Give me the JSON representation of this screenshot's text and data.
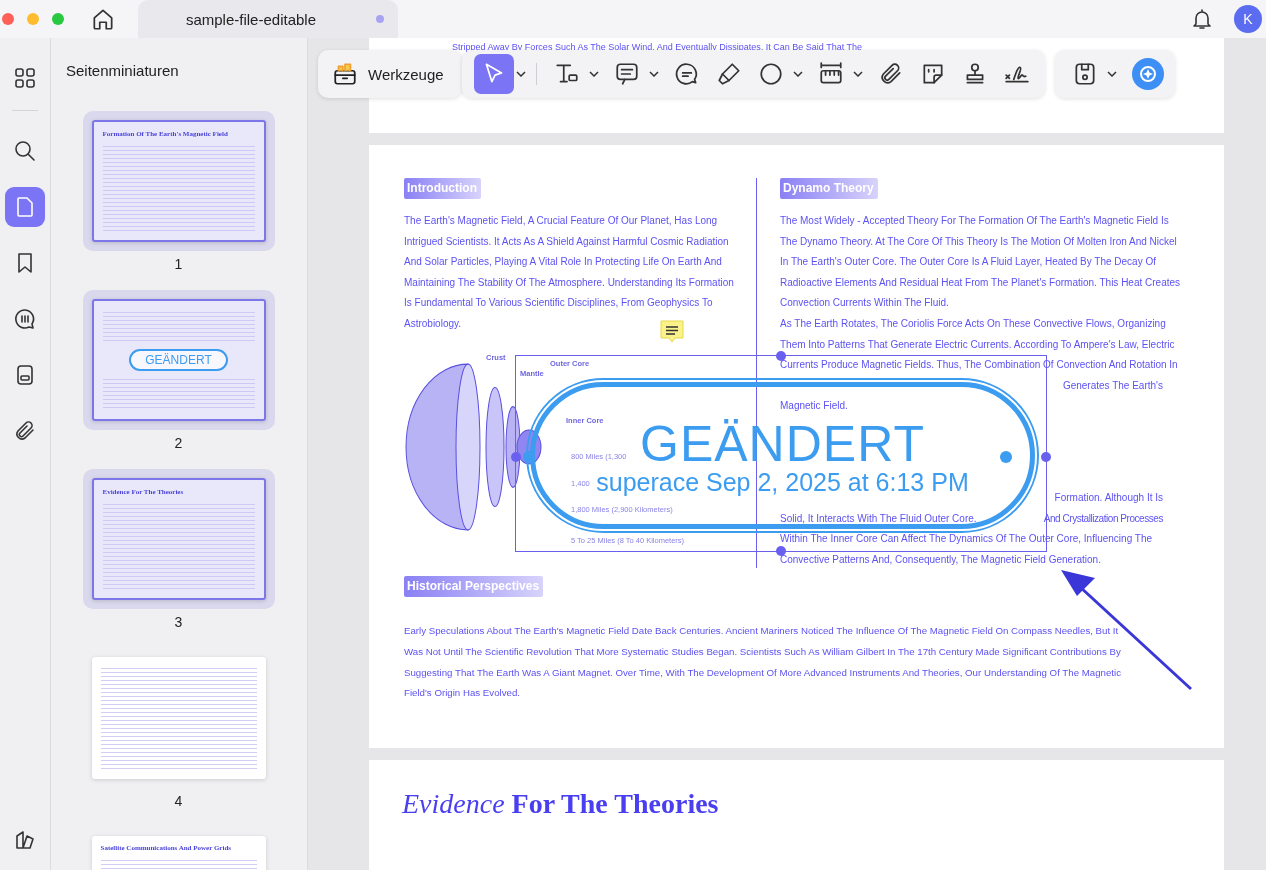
{
  "window": {
    "tab_title": "sample-file-editable",
    "unsaved": true,
    "avatar_initial": "K"
  },
  "rail": {
    "items": [
      {
        "kind": "grid",
        "selected": false
      },
      {
        "kind": "search",
        "selected": false
      },
      {
        "kind": "pages",
        "selected": true
      },
      {
        "kind": "bookmark",
        "selected": false
      },
      {
        "kind": "comments",
        "selected": false
      },
      {
        "kind": "form",
        "selected": false
      },
      {
        "kind": "attachment",
        "selected": false
      }
    ]
  },
  "sidebar": {
    "title": "Seitenminiaturen",
    "thumbnails": [
      {
        "page": "1",
        "selected": true,
        "heading": "Formation Of The Earth's Magnetic Field"
      },
      {
        "page": "2",
        "selected": true,
        "stamp": "GEÄNDERT"
      },
      {
        "page": "3",
        "selected": true,
        "heading": "Evidence For The Theories"
      },
      {
        "page": "4",
        "selected": false
      },
      {
        "heading": "Satellite Communications And Power Grids",
        "selected": false
      }
    ]
  },
  "toolbar": {
    "label": "Werkzeuge",
    "tools": [
      {
        "kind": "select",
        "selected": true,
        "dropdown": true
      },
      {
        "kind": "text",
        "selected": false,
        "dropdown": true
      },
      {
        "kind": "comment",
        "selected": false,
        "dropdown": true
      },
      {
        "kind": "callout",
        "selected": false,
        "dropdown": false
      },
      {
        "kind": "highlighter",
        "selected": false,
        "dropdown": false
      },
      {
        "kind": "circle",
        "selected": false,
        "dropdown": true
      },
      {
        "kind": "ruler",
        "selected": false,
        "dropdown": true
      },
      {
        "kind": "attachment",
        "selected": false,
        "dropdown": false
      },
      {
        "kind": "sticker",
        "selected": false,
        "dropdown": false
      },
      {
        "kind": "stamp",
        "selected": false,
        "dropdown": false
      },
      {
        "kind": "signature",
        "selected": false,
        "dropdown": false
      }
    ],
    "extras": [
      {
        "kind": "save",
        "dropdown": true
      },
      {
        "kind": "ai",
        "dropdown": false
      }
    ]
  },
  "document": {
    "previous_page_line": "Stripped Away By Forces Such As The Solar Wind, And Eventually Dissipates. It Can Be Said That The",
    "page": {
      "intro": {
        "heading": "Introduction",
        "lines": [
          {
            "kind": "full",
            "text": "The Earth's Magnetic Field, A Crucial Feature Of Our Planet, Has Long"
          },
          {
            "kind": "full",
            "text": "Intrigued Scientists. It Acts As A Shield Against Harmful Cosmic Radiation"
          },
          {
            "kind": "full",
            "text": "And Solar Particles, Playing A Vital Role In Protecting Life On Earth And"
          },
          {
            "kind": "full",
            "text": "Maintaining The Stability Of The Atmosphere. Understanding Its Formation"
          },
          {
            "kind": "full",
            "text": "Is Fundamental To Various Scientific Disciplines, From Geophysics To"
          },
          {
            "kind": "full",
            "text": "Astrobiology."
          }
        ]
      },
      "diagram": {
        "labels": [
          "Crust",
          "Mantle",
          "Outer Core",
          "Inner Core"
        ],
        "distances": [
          "800 Miles (1,300",
          "1,400",
          "1,800 Miles (2,900 Kilometers)",
          "5 To 25 Miles (8 To 40 Kilometers)"
        ]
      },
      "dynamo": {
        "heading": "Dynamo Theory",
        "lines": [
          {
            "kind": "full",
            "text": "The Most Widely - Accepted Theory For The Formation Of The Earth's Magnetic Field Is"
          },
          {
            "kind": "full",
            "text": "The Dynamo Theory. At The Core Of This Theory Is The Motion Of Molten Iron And Nickel"
          },
          {
            "kind": "full",
            "text": "In The Earth's Outer Core. The Outer Core Is A Fluid Layer, Heated By The Decay Of"
          },
          {
            "kind": "full",
            "text": "Radioactive Elements And Residual Heat From The Planet's Formation. This Heat Creates"
          },
          {
            "kind": "full",
            "text": "Convection Currents Within The Fluid."
          },
          {
            "kind": "full",
            "text": "As The Earth Rotates, The Coriolis Force Acts On These Convective Flows, Organizing"
          },
          {
            "kind": "full",
            "text": "Them Into Patterns That Generate Electric Currents. According To Ampere's Law, Electric"
          },
          {
            "kind": "full",
            "text": "Currents Produce Magnetic Fields. Thus, The Combination Of Convection And Rotation In"
          },
          {
            "kind": "tail",
            "text": "Generates The Earth's"
          },
          {
            "kind": "full",
            "text": "Magnetic Field."
          }
        ]
      },
      "inner_core": {
        "lines": [
          {
            "kind": "tail",
            "text": "Formation. Although It Is"
          },
          {
            "kind": "split",
            "text": "Solid, It Interacts With The Fluid Outer Core.",
            "rest": "And Crystallization Processes"
          },
          {
            "kind": "full",
            "text": "Within The Inner Core Can Affect The Dynamics Of The Outer Core, Influencing The"
          },
          {
            "kind": "full",
            "text": "Convective Patterns And, Consequently, The Magnetic Field Generation."
          }
        ]
      },
      "history": {
        "heading": "Historical Perspectives",
        "lines": [
          {
            "kind": "full",
            "text": "Early Speculations About The Earth's Magnetic Field Date Back Centuries. Ancient Mariners Noticed The Influence Of The Magnetic Field On Compass Needles, But It"
          },
          {
            "kind": "full",
            "text": "Was Not Until The Scientific Revolution That More Systematic Studies Began. Scientists Such As William Gilbert In The 17th Century Made Significant Contributions By"
          },
          {
            "kind": "full",
            "text": "Suggesting That The Earth Was A Giant Magnet. Over Time, With The Development Of More Advanced Instruments And Theories, Our Understanding Of The Magnetic"
          },
          {
            "kind": "full",
            "text": "Field's Origin Has Evolved."
          }
        ]
      },
      "stamp": {
        "title": "GEÄNDERT",
        "subtitle": "superace Sep 2, 2025 at 6:13 PM",
        "selected": true
      }
    },
    "next_page_heading": "*Evidence* **For The Theories**"
  }
}
